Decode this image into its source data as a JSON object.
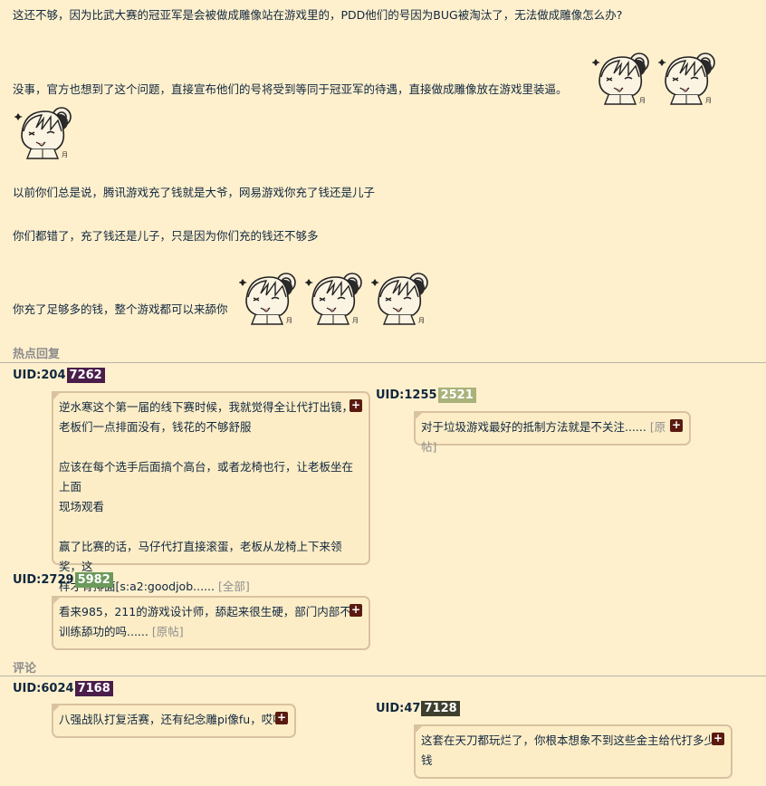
{
  "post": {
    "p1": "这还不够，因为比武大赛的冠亚军是会被做成雕像站在游戏里的，PDD他们的号因为BUG被淘汰了，无法做成雕像怎么办?",
    "p2": "没事，官方也想到了这个问题，直接宣布他们的号将受到等同于冠亚军的待遇，直接做成雕像放在游戏里装逼。",
    "p3": "以前你们总是说，腾讯游戏充了钱就是大爷，网易游戏你充了钱还是儿子",
    "p4": "你们都错了，充了钱还是儿子，只是因为你们充的钱还不够多",
    "p5": "你充了足够多的钱，整个游戏都可以来舔你"
  },
  "sections": {
    "hot_replies": "热点回复",
    "comments": "评论"
  },
  "icons": {
    "sticker": "anime-girl-tongue-sticker-icon",
    "expand": "plus-icon"
  },
  "colors": {
    "background": "#fff0cd",
    "bubble": "#fdedc6",
    "bubble_border": "#d9c2a0",
    "uid_purple": "#4a1d4a",
    "uid_olive": "#a9b27a",
    "uid_green": "#6b9a5b",
    "uid_dark": "#3f3f30",
    "plus_button": "#5a1a10"
  },
  "replies": {
    "r1": {
      "uid_prefix": "UID:204",
      "uid_hl": "7262",
      "lines": [
        "逆水寒这个第一届的线下赛时候，我就觉得全让代打出镜，",
        "老板们一点排面没有，钱花的不够舒服",
        "应该在每个选手后面搞个高台，或者龙椅也行，让老板坐在上面",
        "现场观看",
        "赢了比赛的话，马仔代打直接滚蛋，老板从龙椅上下来领奖，这",
        "样才有排面[s:a2:goodjob......"
      ],
      "more": "[全部]"
    },
    "r2": {
      "uid_prefix": "UID:1255",
      "uid_hl": "2521",
      "text": "对于垃圾游戏最好的抵制方法就是不关注......",
      "more": "[原帖]"
    },
    "r3": {
      "uid_prefix": "UID:2729",
      "uid_hl": "5982",
      "line1": "看来985，211的游戏设计师，舔起来很生硬，部门内部不",
      "line2": "训练舔功的吗......",
      "more": "[原帖]"
    },
    "c1": {
      "uid_prefix": "UID:6024",
      "uid_hl": "7168",
      "text": "八强战队打复活赛，还有纪念雕pi像fu，哎哎"
    },
    "c2": {
      "uid_prefix": "UID:47",
      "uid_hl": "7128",
      "line1": "这套在天刀都玩烂了，你根本想象不到这些金主给代打多少",
      "line2": "钱"
    },
    "plus": "+"
  }
}
